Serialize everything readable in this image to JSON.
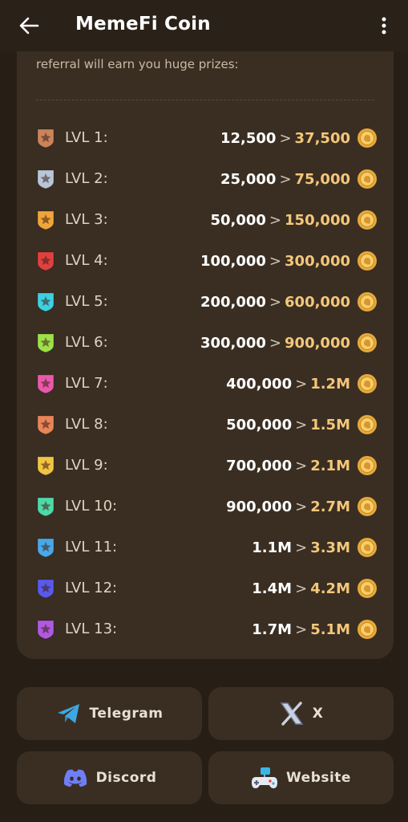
{
  "header": {
    "title": "MemeFi Coin",
    "back_icon": "arrow-left-icon",
    "more_icon": "more-vertical-icon"
  },
  "referral": {
    "intro": "referral will earn you huge prizes:",
    "levels": [
      {
        "label": "LVL 1:",
        "from": "12,500",
        "to": "37,500",
        "badge_color": "#c9845a"
      },
      {
        "label": "LVL 2:",
        "from": "25,000",
        "to": "75,000",
        "badge_color": "#b9c6d6"
      },
      {
        "label": "LVL 3:",
        "from": "50,000",
        "to": "150,000",
        "badge_color": "#f0a53a"
      },
      {
        "label": "LVL 4:",
        "from": "100,000",
        "to": "300,000",
        "badge_color": "#e2403e"
      },
      {
        "label": "LVL 5:",
        "from": "200,000",
        "to": "600,000",
        "badge_color": "#3fd0e0"
      },
      {
        "label": "LVL 6:",
        "from": "300,000",
        "to": "900,000",
        "badge_color": "#9ee04a"
      },
      {
        "label": "LVL 7:",
        "from": "400,000",
        "to": "1.2M",
        "badge_color": "#e85aa9"
      },
      {
        "label": "LVL 8:",
        "from": "500,000",
        "to": "1.5M",
        "badge_color": "#e8855a"
      },
      {
        "label": "LVL 9:",
        "from": "700,000",
        "to": "2.1M",
        "badge_color": "#f2c443"
      },
      {
        "label": "LVL 10:",
        "from": "900,000",
        "to": "2.7M",
        "badge_color": "#4fd8a8"
      },
      {
        "label": "LVL 11:",
        "from": "1.1M",
        "to": "3.3M",
        "badge_color": "#4aa8e8"
      },
      {
        "label": "LVL 12:",
        "from": "1.4M",
        "to": "4.2M",
        "badge_color": "#5a5ae8"
      },
      {
        "label": "LVL 13:",
        "from": "1.7M",
        "to": "5.1M",
        "badge_color": "#b05ae0"
      }
    ],
    "separator": ">",
    "coin_icon": "memefi-coin-icon"
  },
  "links": {
    "telegram": {
      "label": "Telegram",
      "icon": "telegram-icon"
    },
    "x": {
      "label": "X",
      "icon": "x-logo-icon"
    },
    "discord": {
      "label": "Discord",
      "icon": "discord-icon"
    },
    "website": {
      "label": "Website",
      "icon": "gamepad-icon"
    }
  },
  "colors": {
    "background": "#271f16",
    "card": "#3a2e22",
    "accent_gold": "#f3c77a"
  }
}
